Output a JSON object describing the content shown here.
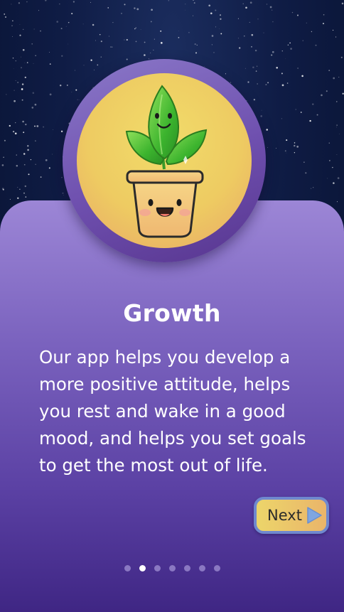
{
  "screen": {
    "title": "Growth",
    "description": "Our app helps you develop a more positive attitude, helps you rest and wake in a good mood, and helps you set goals to get the most out of life.",
    "illustration_icon": "smiling-plant-pot-icon"
  },
  "next_button": {
    "label": "Next",
    "icon": "play-arrow-icon"
  },
  "pagination": {
    "total": 7,
    "current": 2
  },
  "colors": {
    "card_top": "#9c86d6",
    "card_bottom": "#3f2684",
    "badge_fill": "#f1dc6a",
    "badge_ring": "#6e4fae",
    "button_border": "#6f88cf",
    "button_fill": "#ecd56a",
    "sky": "#0f1c45"
  }
}
